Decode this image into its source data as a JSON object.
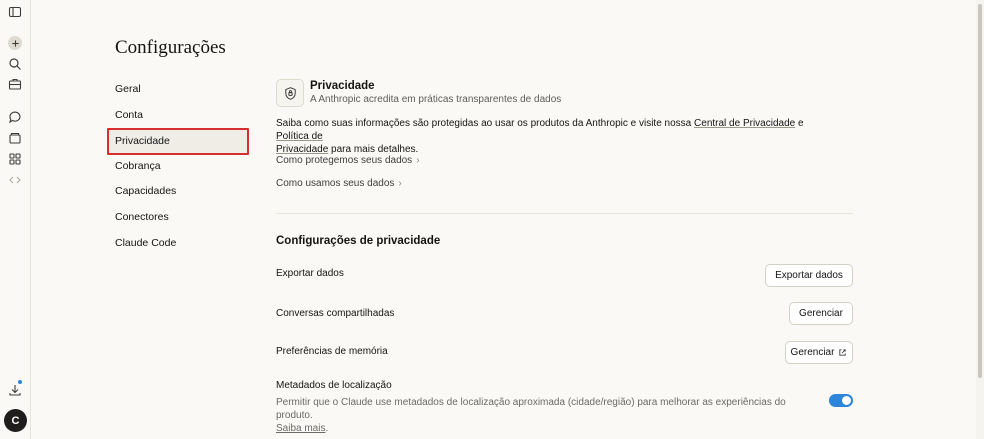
{
  "rail": {
    "icons": [
      "sidebar-toggle-icon",
      "new-chat-icon",
      "search-icon",
      "briefcase-icon",
      "chat-icon",
      "projects-icon",
      "artifacts-icon",
      "code-icon",
      "download-icon"
    ],
    "avatar_letter": "C"
  },
  "page": {
    "title": "Configurações"
  },
  "nav": {
    "items": [
      {
        "label": "Geral"
      },
      {
        "label": "Conta"
      },
      {
        "label": "Privacidade"
      },
      {
        "label": "Cobrança"
      },
      {
        "label": "Capacidades"
      },
      {
        "label": "Conectores"
      },
      {
        "label": "Claude Code"
      }
    ],
    "active": "Privacidade"
  },
  "privacy": {
    "title": "Privacidade",
    "subtitle": "A Anthropic acredita em práticas transparentes de dados",
    "para_1": "Saiba como suas informações são protegidas ao usar os produtos da Anthropic e visite nossa ",
    "link_center": "Central de Privacidade",
    "para_and": " e ",
    "link_policy_1": "Política de",
    "link_policy_2": "Privacidade",
    "para_end": " para mais detalhes.",
    "link_protect": "Como protegemos seus dados",
    "link_use": "Como usamos seus dados"
  },
  "settings": {
    "heading": "Configurações de privacidade",
    "export_label": "Exportar dados",
    "export_button": "Exportar dados",
    "shared_label": "Conversas compartilhadas",
    "shared_button": "Gerenciar",
    "memory_label": "Preferências de memória",
    "memory_button": "Gerenciar",
    "location_label": "Metadados de localização",
    "location_desc": "Permitir que o Claude use metadados de localização aproximada (cidade/região) para melhorar as experiências do produto.",
    "location_link": "Saiba mais",
    "location_enabled": true
  },
  "colors": {
    "accent": "#2c84db",
    "highlight_border": "#d32f2f",
    "background": "#faf9f5"
  }
}
